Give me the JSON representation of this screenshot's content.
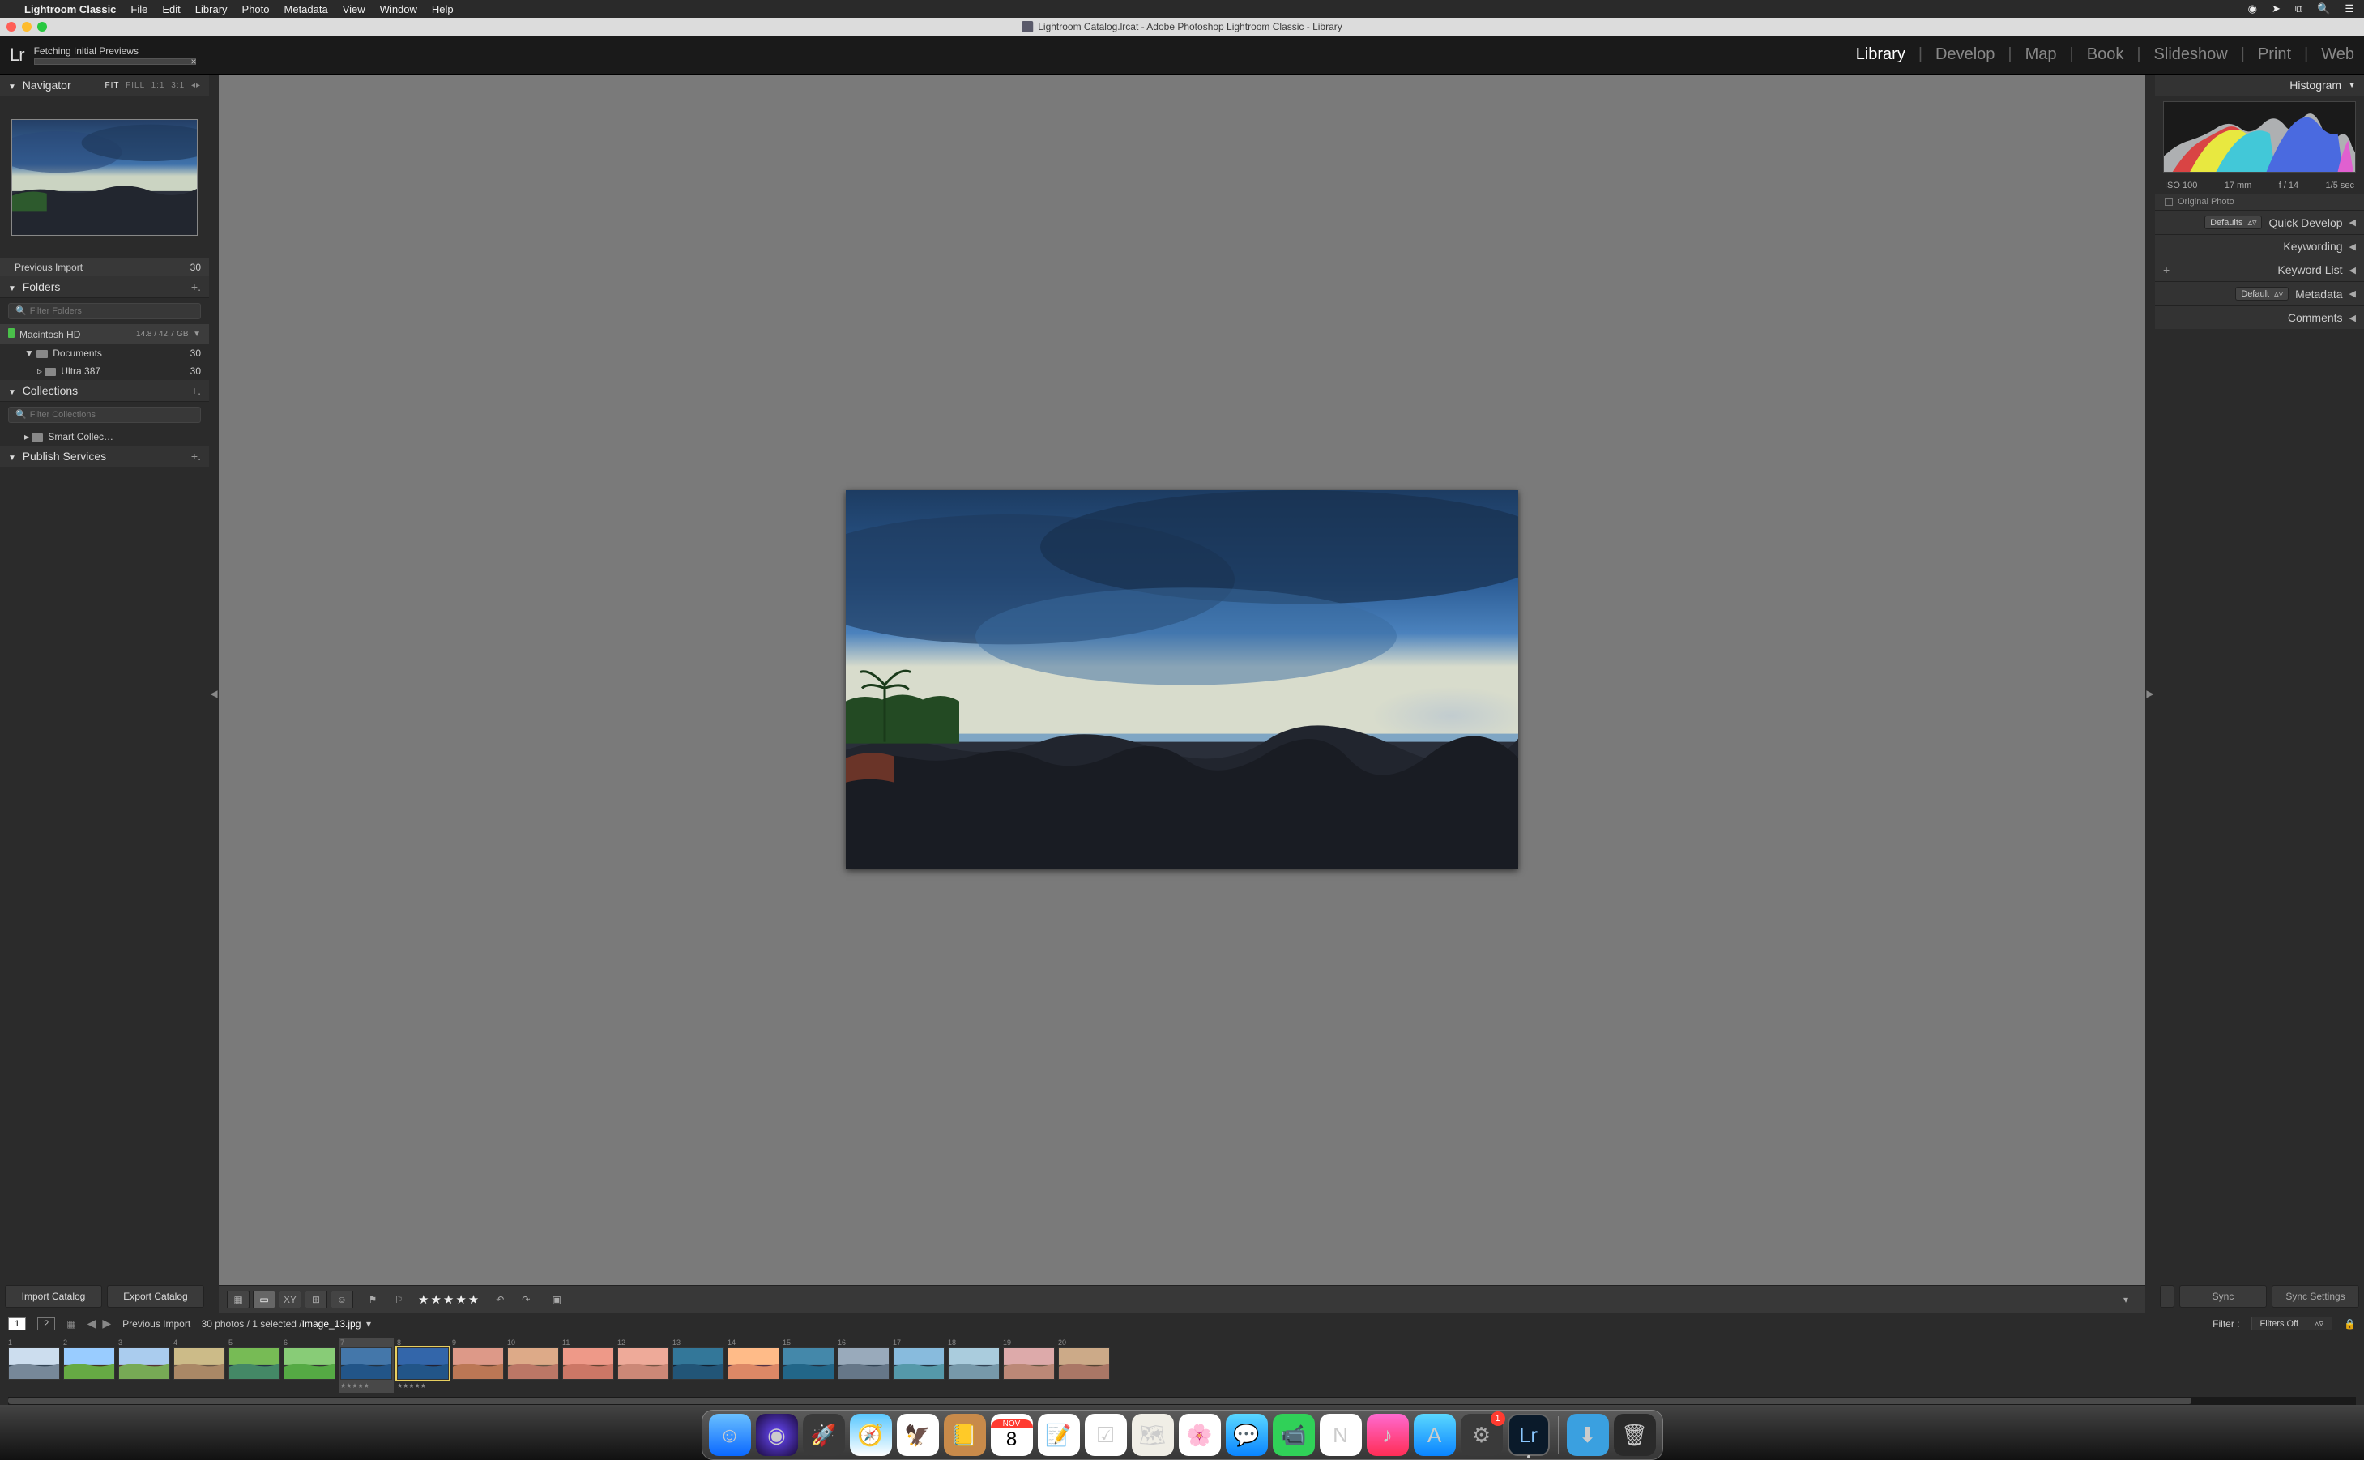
{
  "menubar": {
    "app": "Lightroom Classic",
    "items": [
      "File",
      "Edit",
      "Library",
      "Photo",
      "Metadata",
      "View",
      "Window",
      "Help"
    ]
  },
  "window": {
    "title": "Lightroom Catalog.lrcat - Adobe Photoshop Lightroom Classic - Library"
  },
  "identity": {
    "logo": "Lr",
    "task": "Fetching Initial Previews",
    "modules": [
      "Library",
      "Develop",
      "Map",
      "Book",
      "Slideshow",
      "Print",
      "Web"
    ],
    "active_module": "Library"
  },
  "navigator": {
    "title": "Navigator",
    "zoom": {
      "fit": "FIT",
      "fill": "FILL",
      "one": "1:1",
      "three": "3:1"
    }
  },
  "catalog": {
    "previous_import_label": "Previous Import",
    "previous_import_count": "30"
  },
  "folders": {
    "title": "Folders",
    "filter_placeholder": "Filter Folders",
    "volume": "Macintosh HD",
    "volume_space": "14.8 / 42.7 GB",
    "items": [
      {
        "name": "Documents",
        "count": "30"
      },
      {
        "name": "Ultra 387",
        "count": "30"
      }
    ]
  },
  "collections": {
    "title": "Collections",
    "filter_placeholder": "Filter Collections",
    "smart": "Smart Collec…"
  },
  "publish": {
    "title": "Publish Services"
  },
  "import": {
    "import_btn": "Import Catalog",
    "export_btn": "Export Catalog"
  },
  "histogram": {
    "title": "Histogram",
    "iso": "ISO 100",
    "focal": "17 mm",
    "aperture": "f / 14",
    "shutter": "1/5 sec",
    "original": "Original Photo"
  },
  "right_panels": {
    "defaults": "Defaults",
    "quick_develop": "Quick Develop",
    "keywording": "Keywording",
    "keyword_list": "Keyword List",
    "metadata": "Metadata",
    "metadata_preset": "Default",
    "comments": "Comments"
  },
  "sync": {
    "sync": "Sync",
    "sync_settings": "Sync Settings"
  },
  "toolbar": {
    "stars": "★★★★★"
  },
  "filmstrip_header": {
    "mon1": "1",
    "mon2": "2",
    "source": "Previous Import",
    "count": "30 photos",
    "selected": "1 selected",
    "filename": "Image_13.jpg",
    "filter_label": "Filter :",
    "filter_value": "Filters Off"
  },
  "filmstrip": {
    "numbers": [
      "1",
      "2",
      "3",
      "4",
      "5",
      "6",
      "7",
      "8",
      "9",
      "10",
      "11",
      "12",
      "13",
      "14",
      "15",
      "16",
      "17",
      "18",
      "19",
      "20"
    ],
    "selected_index": 7,
    "context_index": 6
  },
  "dock": {
    "badge": "1",
    "cal_month": "NOV",
    "cal_day": "8"
  }
}
